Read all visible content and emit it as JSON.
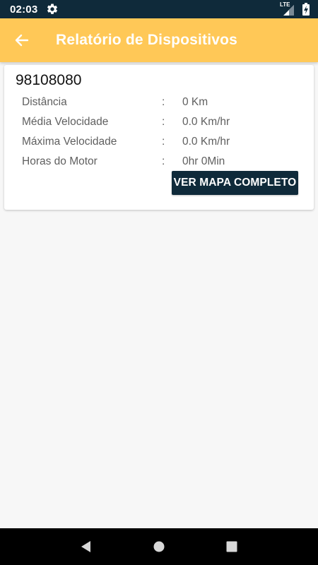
{
  "status_bar": {
    "time": "02:03",
    "network": "LTE",
    "icons": [
      "settings-gear-icon",
      "signal-icon",
      "battery-charging-icon"
    ]
  },
  "app_bar": {
    "title": "Relatório de Dispositivos",
    "back_icon": "back-arrow-icon",
    "color": "#ffc857"
  },
  "device": {
    "id": "98108080",
    "rows": [
      {
        "label": "Distância",
        "separator": ":",
        "value": "0 Km"
      },
      {
        "label": "Média Velocidade",
        "separator": ":",
        "value": "0.0 Km/hr"
      },
      {
        "label": "Máxima Velocidade",
        "separator": ":",
        "value": "0.0 Km/hr"
      },
      {
        "label": "Horas do Motor",
        "separator": ":",
        "value": "0hr 0Min"
      }
    ],
    "map_button_label": "VER MAPA COMPLETO",
    "button_color": "#0f2a3a"
  },
  "nav_bar": {
    "buttons": [
      "back-triangle-icon",
      "home-circle-icon",
      "recents-square-icon"
    ]
  }
}
